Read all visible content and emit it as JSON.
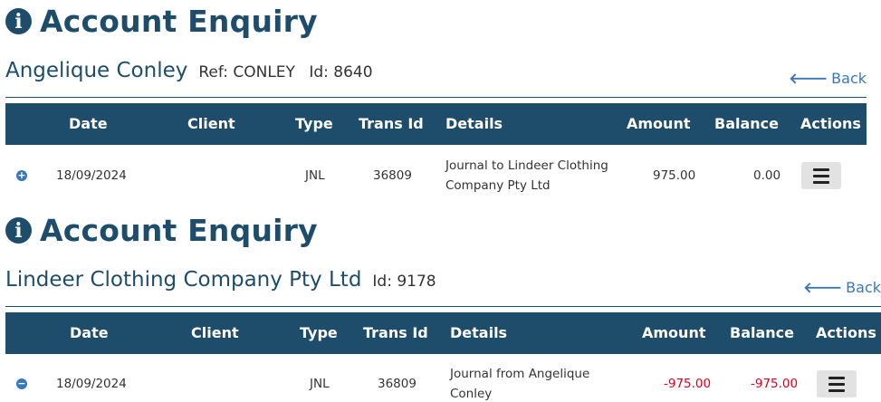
{
  "enquiries": [
    {
      "title": "Account Enquiry",
      "account_name": "Angelique Conley",
      "ref": "Ref: CONLEY",
      "id": "Id: 8640",
      "back_label": "Back",
      "columns": [
        "Date",
        "Client",
        "Type",
        "Trans Id",
        "Details",
        "Amount",
        "Balance",
        "Actions"
      ],
      "row": {
        "toggle": "+",
        "date": "18/09/2024",
        "client": "",
        "type": "JNL",
        "trans_id": "36809",
        "details": "Journal to Lindeer Clothing Company Pty Ltd",
        "amount": "975.00",
        "balance": "0.00"
      }
    },
    {
      "title": "Account Enquiry",
      "account_name": "Lindeer Clothing Company Pty Ltd",
      "ref": "",
      "id": "Id: 9178",
      "back_label": "Back",
      "columns": [
        "Date",
        "Client",
        "Type",
        "Trans Id",
        "Details",
        "Amount",
        "Balance",
        "Actions"
      ],
      "row": {
        "toggle": "−",
        "date": "18/09/2024",
        "client": "",
        "type": "JNL",
        "trans_id": "36809",
        "details": "Journal from Angelique Conley",
        "amount": "-975.00",
        "balance": "-975.00"
      }
    }
  ],
  "colors": {
    "primary": "#1e4d6b",
    "link": "#3a77b8",
    "negative": "#d9001b"
  }
}
